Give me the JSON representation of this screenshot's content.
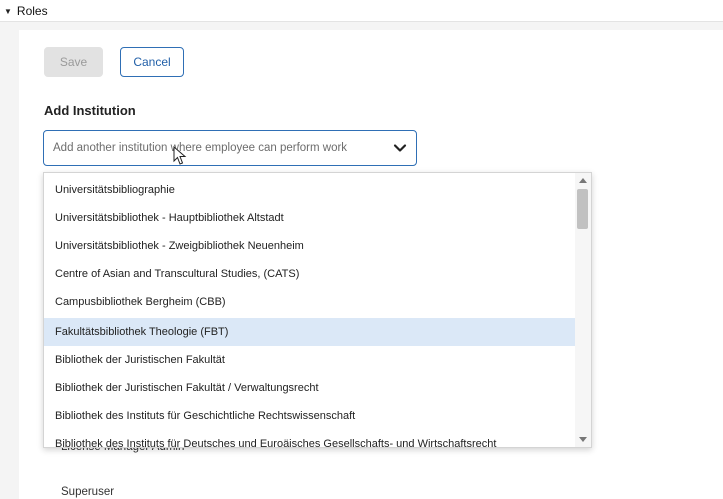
{
  "header": {
    "toggle_icon": "caret-down-icon",
    "title": "Roles"
  },
  "actions": {
    "save_label": "Save",
    "cancel_label": "Cancel"
  },
  "section": {
    "title": "Add Institution"
  },
  "select": {
    "placeholder": "Add another institution where employee can perform work",
    "chevron_icon": "chevron-down-icon",
    "options": [
      "Universitätsbibliographie",
      "Universitätsbibliothek - Hauptbibliothek Altstadt",
      "Universitätsbibliothek - Zweigbibliothek Neuenheim",
      "Centre of Asian and Transcultural Studies, (CATS)",
      "Campusbibliothek Bergheim (CBB)",
      "Fakultätsbibliothek Theologie (FBT)",
      "Bibliothek der Juristischen Fakultät",
      "Bibliothek der Juristischen Fakultät / Verwaltungsrecht",
      "Bibliothek des Instituts für Geschichtliche Rechtswissenschaft",
      "Bibliothek des Instituts für Deutsches und Euroäisches Gesellschafts- und Wirtschaftsrecht"
    ],
    "highlighted_index": 5
  },
  "roles": [
    {
      "label": "License Manager Admin"
    },
    {
      "label": "Superuser"
    }
  ],
  "colors": {
    "accent": "#2f6fb5",
    "highlight": "#dbe8f7",
    "disabled": "#e2e2e2"
  }
}
